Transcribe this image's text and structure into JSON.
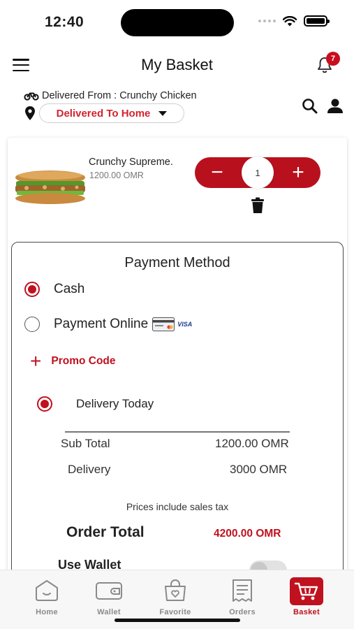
{
  "status_bar": {
    "time": "12:40"
  },
  "header": {
    "title": "My Basket",
    "notification_count": "7"
  },
  "delivery": {
    "from_label": "Delivered From : Crunchy Chicken",
    "to_value": "Delivered To Home"
  },
  "cart": {
    "items": [
      {
        "name": "Crunchy Supreme.",
        "price": "1200.00 OMR",
        "quantity": "1"
      }
    ],
    "minus_label": "−",
    "plus_label": "+"
  },
  "payment": {
    "title": "Payment Method",
    "options": [
      {
        "label": "Cash",
        "selected": true
      },
      {
        "label": "Payment Online",
        "selected": false,
        "badge": "VISA"
      }
    ],
    "promo_label": "Promo Code",
    "delivery_option": {
      "label": "Delivery Today",
      "selected": true
    }
  },
  "summary": {
    "subtotal_label": "Sub Total",
    "subtotal_value": "1200.00 OMR",
    "delivery_label": "Delivery",
    "delivery_value": "3000 OMR",
    "tax_note": "Prices include sales tax",
    "total_label": "Order Total",
    "total_value": "4200.00 OMR",
    "wallet_label": "Use Wallet",
    "wallet_enabled": false
  },
  "tabs": [
    {
      "label": "Home",
      "icon": "home-icon",
      "active": false
    },
    {
      "label": "Wallet",
      "icon": "wallet-icon",
      "active": false
    },
    {
      "label": "Favorite",
      "icon": "favorite-bag-icon",
      "active": false
    },
    {
      "label": "Orders",
      "icon": "orders-icon",
      "active": false
    },
    {
      "label": "Basket",
      "icon": "basket-icon",
      "active": true
    }
  ],
  "colors": {
    "accent": "#c0111f",
    "stepper": "#b8111d",
    "tab_inactive": "#8a8a8a"
  }
}
